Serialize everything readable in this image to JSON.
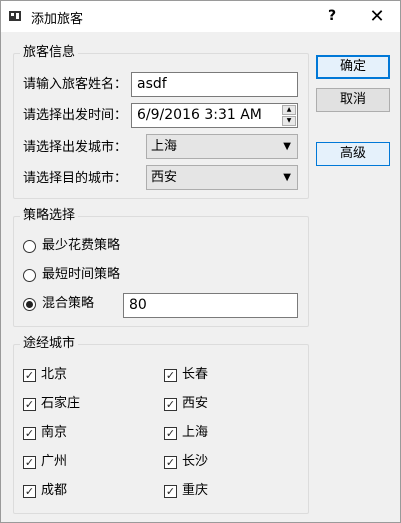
{
  "window": {
    "title": "添加旅客",
    "help_label": "?",
    "close_label": "✕"
  },
  "traveler_info": {
    "title": "旅客信息",
    "name_label": "请输入旅客姓名：",
    "name_value": "asdf",
    "time_label": "请选择出发时间：",
    "time_value": "6/9/2016 3:31 AM",
    "origin_label": "请选择出发城市：",
    "origin_value": "上海",
    "dest_label": "请选择目的城市：",
    "dest_value": "西安"
  },
  "strategy": {
    "title": "策略选择",
    "options": [
      "最少花费策略",
      "最短时间策略",
      "混合策略"
    ],
    "mix_value": "80"
  },
  "via_cities": {
    "title": "途经城市",
    "left": [
      "北京",
      "石家庄",
      "南京",
      "广州",
      "成都"
    ],
    "right": [
      "长春",
      "西安",
      "上海",
      "长沙",
      "重庆"
    ],
    "check_glyph": "✓"
  },
  "buttons": {
    "ok": "确定",
    "cancel": "取消",
    "advanced": "高级"
  },
  "icons": {
    "dropdown": "▼",
    "spin_up": "▲",
    "spin_down": "▼"
  }
}
